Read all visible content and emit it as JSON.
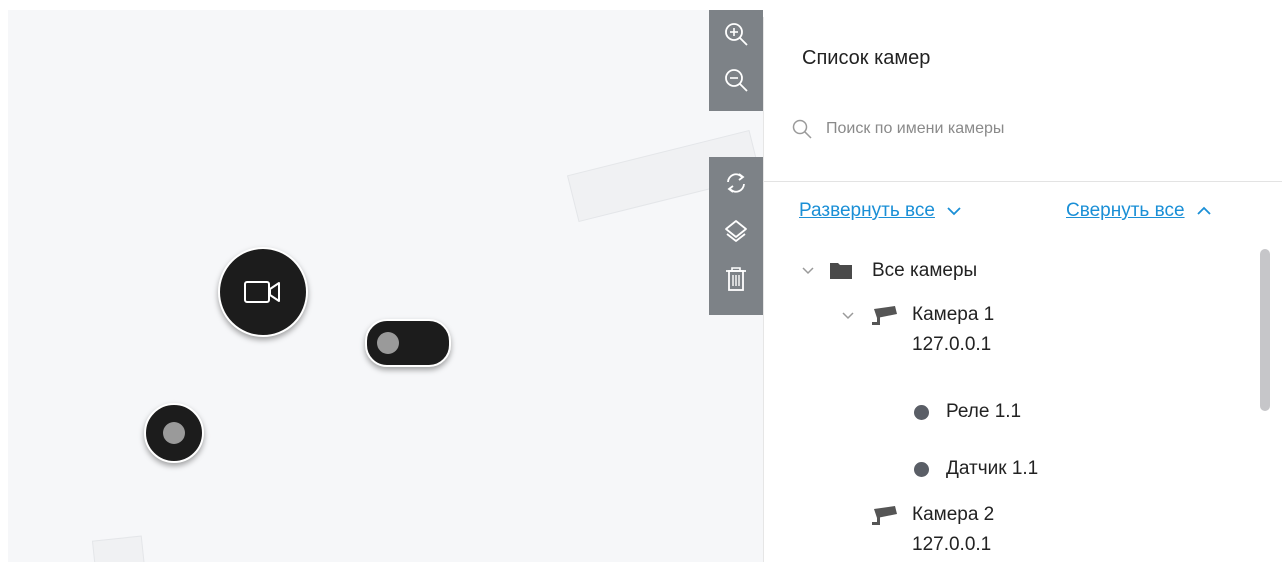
{
  "toolbar": {
    "zoom_in": "zoom-in-icon",
    "zoom_out": "zoom-out-icon",
    "refresh": "refresh-icon",
    "layers": "layers-icon",
    "delete": "trash-icon"
  },
  "map": {
    "markers": [
      {
        "type": "camera",
        "icon": "video-camera-icon"
      },
      {
        "type": "relay",
        "icon": "toggle-icon"
      },
      {
        "type": "sensor",
        "icon": "sensor-dot-icon"
      }
    ]
  },
  "panel": {
    "title": "Список камер",
    "search_placeholder": "Поиск по имени камеры",
    "expand_all": "Развернуть все",
    "collapse_all": "Свернуть все",
    "tree": {
      "root_label": "Все камеры",
      "camera1_name": "Камера 1",
      "camera1_ip": "127.0.0.1",
      "relay_label": "Реле 1.1",
      "sensor_label": "Датчик 1.1",
      "camera2_name": "Камера 2",
      "camera2_ip": "127.0.0.1"
    }
  },
  "colors": {
    "toolbar_bg": "#7d8287",
    "marker_bg": "#1c1c1c",
    "link": "#1a8fd6",
    "map_bg": "#f6f7f9"
  }
}
